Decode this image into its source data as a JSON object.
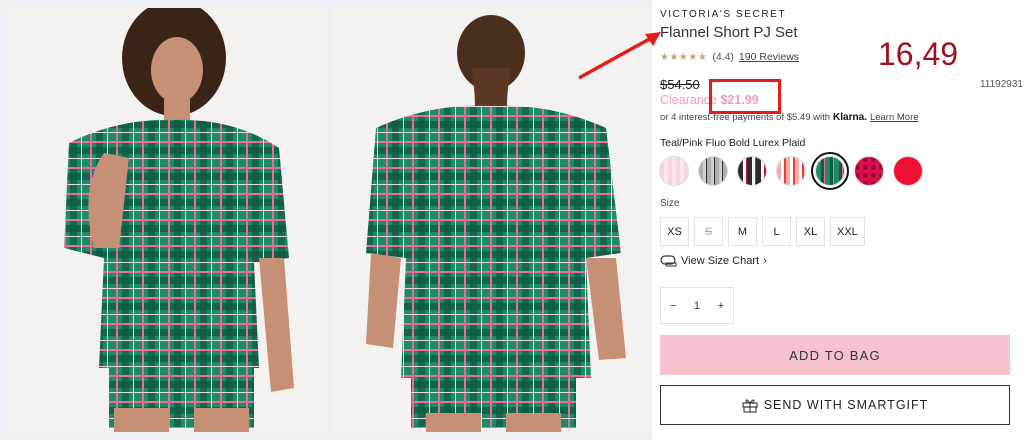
{
  "product": {
    "brand": "VICTORIA'S SECRET",
    "title": "Flannel Short PJ Set",
    "stars": "★★★★★",
    "rating": "(4.4)",
    "reviews": "190 Reviews",
    "old_price": "$54.50",
    "sku": "11192931",
    "clearance_label": "Clearance",
    "clearance_price": "$21.99",
    "klarna_text": "or 4 interest-free payments of $5.49 with",
    "klarna_brand": "Klarna.",
    "klarna_link": "Learn More",
    "color_label": "Teal/Pink Fluo Bold Lurex Plaid",
    "size_label": "Size",
    "sizes": [
      "XS",
      "S",
      "M",
      "L",
      "XL",
      "XXL"
    ],
    "size_chart": "View Size Chart",
    "size_chart_chevron": "›",
    "qty_minus": "−",
    "qty_value": "1",
    "qty_plus": "+",
    "add_to_bag": "ADD TO BAG",
    "smartgift": "SEND WITH SMARTGIFT"
  },
  "annotation": {
    "number": "16,49"
  },
  "colors": {
    "clearance": "#f29cb8",
    "add_bag_bg": "#f6c2cd",
    "annotation_red": "#e21b1b",
    "annotation_number": "#a0101e",
    "swatches": [
      "#f7d6df",
      "#d8dcdc",
      "#2b2b2b",
      "#f3b0a8",
      "#1f8a62",
      "#d9124f",
      "#ee1133"
    ]
  },
  "icons": [
    "gift-icon",
    "measuring-tape-icon",
    "arrow-annotation"
  ]
}
